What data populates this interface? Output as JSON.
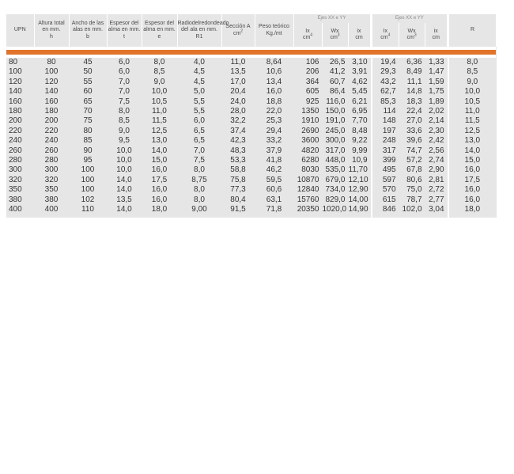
{
  "headers": {
    "upn": "UPN",
    "altura": [
      "Altura total",
      "en mm.",
      "h"
    ],
    "ancho": [
      "Ancho de las",
      "alas en mm.",
      "b"
    ],
    "espesor_ala": [
      "Espesor del",
      "alma en mm.",
      "t"
    ],
    "espesor_alma": [
      "Espesor del",
      "alma en mm.",
      "e"
    ],
    "radio": [
      "Radiodelredondeado",
      "del ala en mm.",
      "R1"
    ],
    "seccion": [
      "Sección A",
      "cm",
      "2"
    ],
    "peso": [
      "Peso teórico",
      "Kg./mt"
    ],
    "group1": "Ejes XX e YY",
    "group2": "Ejes XX e YY",
    "ix1": [
      "Ix",
      "cm",
      "4"
    ],
    "wx1": [
      "Wx",
      "cm",
      "3"
    ],
    "iix1": [
      "ix",
      "cm"
    ],
    "ix2": [
      "Ix",
      "cm",
      "4"
    ],
    "wx2": [
      "Wx",
      "cm",
      "3"
    ],
    "iix2": [
      "ix",
      "cm"
    ],
    "r": "R"
  },
  "rows": [
    [
      "80",
      "80",
      "45",
      "6,0",
      "8,0",
      "4,0",
      "11,0",
      "8,64",
      "106",
      "26,5",
      "3,10",
      "19,4",
      "6,36",
      "1,33",
      "8,0"
    ],
    [
      "100",
      "100",
      "50",
      "6,0",
      "8,5",
      "4,5",
      "13,5",
      "10,6",
      "206",
      "41,2",
      "3,91",
      "29,3",
      "8,49",
      "1,47",
      "8,5"
    ],
    [
      "120",
      "120",
      "55",
      "7,0",
      "9,0",
      "4,5",
      "17,0",
      "13,4",
      "364",
      "60,7",
      "4,62",
      "43,2",
      "11,1",
      "1,59",
      "9,0"
    ],
    [
      "140",
      "140",
      "60",
      "7,0",
      "10,0",
      "5,0",
      "20,4",
      "16,0",
      "605",
      "86,4",
      "5,45",
      "62,7",
      "14,8",
      "1,75",
      "10,0"
    ],
    [
      "160",
      "160",
      "65",
      "7,5",
      "10,5",
      "5,5",
      "24,0",
      "18,8",
      "925",
      "116,0",
      "6,21",
      "85,3",
      "18,3",
      "1,89",
      "10,5"
    ],
    [
      "180",
      "180",
      "70",
      "8,0",
      "11,0",
      "5,5",
      "28,0",
      "22,0",
      "1350",
      "150,0",
      "6,95",
      "114",
      "22,4",
      "2,02",
      "11,0"
    ],
    [
      "200",
      "200",
      "75",
      "8,5",
      "11,5",
      "6,0",
      "32,2",
      "25,3",
      "1910",
      "191,0",
      "7,70",
      "148",
      "27,0",
      "2,14",
      "11,5"
    ],
    [
      "220",
      "220",
      "80",
      "9,0",
      "12,5",
      "6,5",
      "37,4",
      "29,4",
      "2690",
      "245,0",
      "8,48",
      "197",
      "33,6",
      "2,30",
      "12,5"
    ],
    [
      "240",
      "240",
      "85",
      "9,5",
      "13,0",
      "6,5",
      "42,3",
      "33,2",
      "3600",
      "300,0",
      "9,22",
      "248",
      "39,6",
      "2,42",
      "13,0"
    ],
    [
      "260",
      "260",
      "90",
      "10,0",
      "14,0",
      "7,0",
      "48,3",
      "37,9",
      "4820",
      "317,0",
      "9,99",
      "317",
      "74,7",
      "2,56",
      "14,0"
    ],
    [
      "280",
      "280",
      "95",
      "10,0",
      "15,0",
      "7,5",
      "53,3",
      "41,8",
      "6280",
      "448,0",
      "10,9",
      "399",
      "57,2",
      "2,74",
      "15,0"
    ],
    [
      "300",
      "300",
      "100",
      "10,0",
      "16,0",
      "8,0",
      "58,8",
      "46,2",
      "8030",
      "535,0",
      "11,70",
      "495",
      "67,8",
      "2,90",
      "16,0"
    ],
    [
      "320",
      "320",
      "100",
      "14,0",
      "17,5",
      "8,75",
      "75,8",
      "59,5",
      "10870",
      "679,0",
      "12,10",
      "597",
      "80,6",
      "2,81",
      "17,5"
    ],
    [
      "350",
      "350",
      "100",
      "14,0",
      "16,0",
      "8,0",
      "77,3",
      "60,6",
      "12840",
      "734,0",
      "12,90",
      "570",
      "75,0",
      "2,72",
      "16,0"
    ],
    [
      "380",
      "380",
      "102",
      "13,5",
      "16,0",
      "8,0",
      "80,4",
      "63,1",
      "15760",
      "829,0",
      "14,00",
      "615",
      "78,7",
      "2,77",
      "16,0"
    ],
    [
      "400",
      "400",
      "110",
      "14,0",
      "18,0",
      "9,00",
      "91,5",
      "71,8",
      "20350",
      "1020,0",
      "14,90",
      "846",
      "102,0",
      "3,04",
      "18,0"
    ]
  ],
  "colors": {
    "band": "#e6e6e6",
    "accent": "#e2732b"
  }
}
